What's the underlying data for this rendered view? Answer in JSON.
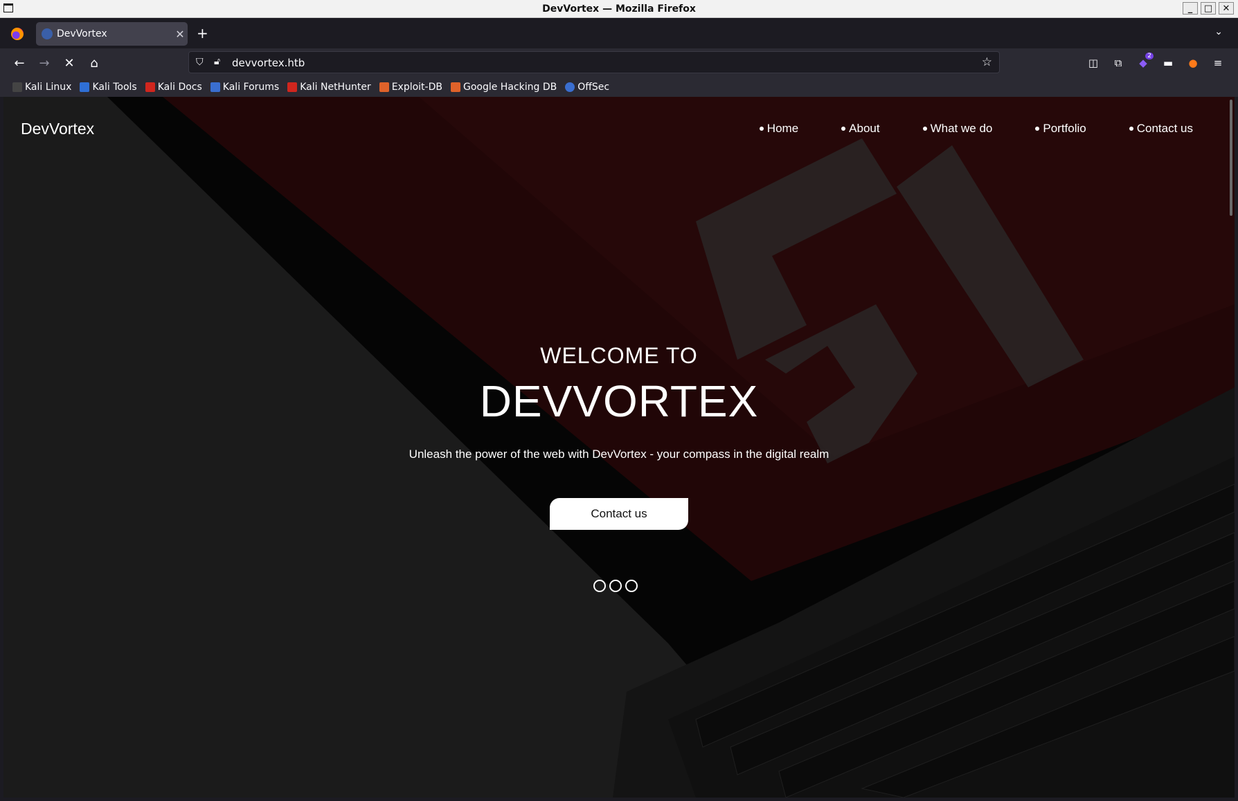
{
  "window": {
    "title": "DevVortex — Mozilla Firefox"
  },
  "browser": {
    "tab": {
      "title": "DevVortex"
    },
    "url": "devvortex.htb",
    "extension_badge": "2",
    "bookmarks": [
      {
        "label": "Kali Linux",
        "color": "#1a1a1a"
      },
      {
        "label": "Kali Tools",
        "color": "#2f6fd6"
      },
      {
        "label": "Kali Docs",
        "color": "#d0261e"
      },
      {
        "label": "Kali Forums",
        "color": "#3a6ecf"
      },
      {
        "label": "Kali NetHunter",
        "color": "#d0261e"
      },
      {
        "label": "Exploit-DB",
        "color": "#e0622a"
      },
      {
        "label": "Google Hacking DB",
        "color": "#e0622a"
      },
      {
        "label": "OffSec",
        "color": "#3a6ecf"
      }
    ]
  },
  "site": {
    "brand": "DevVortex",
    "nav": [
      {
        "label": "Home"
      },
      {
        "label": "About"
      },
      {
        "label": "What we do"
      },
      {
        "label": "Portfolio"
      },
      {
        "label": "Contact us"
      }
    ],
    "hero": {
      "subtitle": "WELCOME TO",
      "title": "DEVVORTEX",
      "tagline": "Unleash the power of the web with DevVortex - your compass in the digital realm",
      "cta_label": "Contact us",
      "slides": 3
    }
  }
}
